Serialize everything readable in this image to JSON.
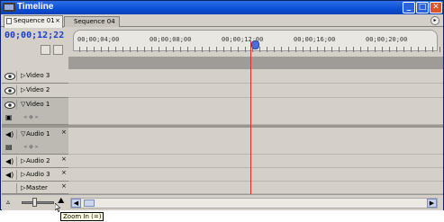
{
  "window": {
    "title": "Timeline"
  },
  "tabs": [
    {
      "label": "Sequence 01",
      "close": "×",
      "active": true
    },
    {
      "label": "Sequence 04",
      "active": false
    }
  ],
  "header": {
    "timecode": "00;00;12;22"
  },
  "ruler": {
    "labels": [
      "00;00;04;00",
      "00;00;08;00",
      "00;00;12;00",
      "00;00;16;00",
      "00;00;20;00"
    ]
  },
  "tracks": [
    {
      "name": "Video 3",
      "type": "video",
      "expanded": false
    },
    {
      "name": "Video 2",
      "type": "video",
      "expanded": false
    },
    {
      "name": "Video 1",
      "type": "video",
      "expanded": true
    },
    {
      "name": "Audio 1",
      "type": "audio",
      "expanded": true,
      "marker": "×"
    },
    {
      "name": "Audio 2",
      "type": "audio",
      "expanded": false,
      "marker": "×"
    },
    {
      "name": "Audio 3",
      "type": "audio",
      "expanded": false,
      "marker": "×"
    },
    {
      "name": "Master",
      "type": "audio",
      "expanded": false,
      "marker": "×"
    }
  ],
  "tooltip": {
    "text": "Zoom In (=)"
  },
  "colors": {
    "accent": "#1a3ccc",
    "playhead": "#d43030",
    "titlebar": "#0a4fd6"
  }
}
